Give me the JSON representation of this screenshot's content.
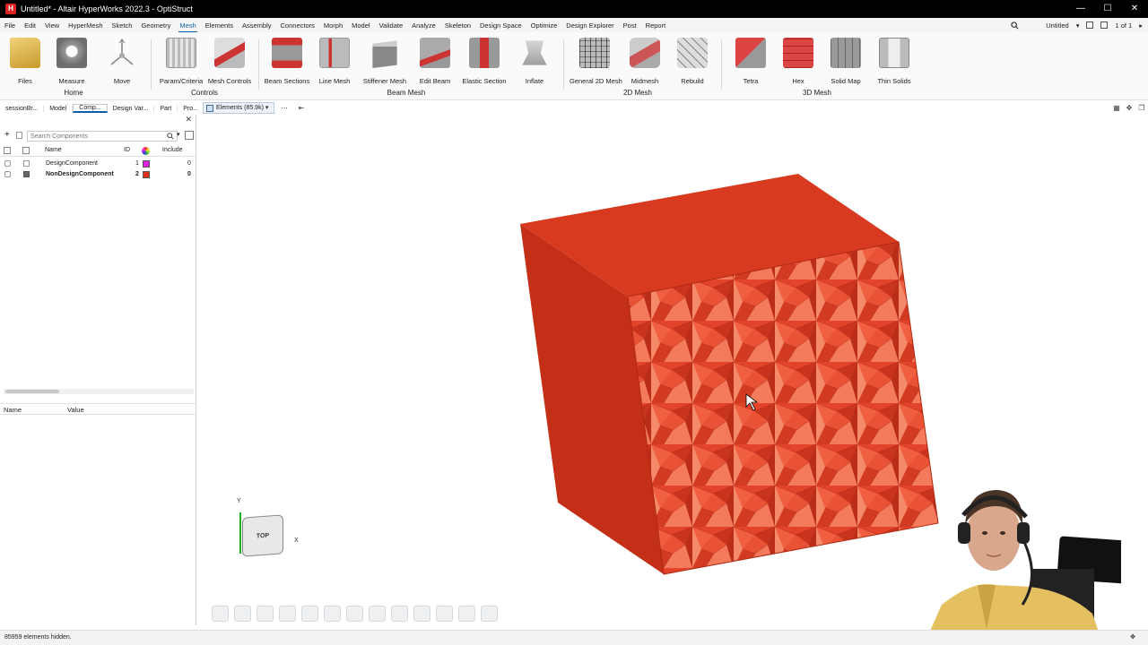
{
  "window": {
    "title": "Untitled* - Altair HyperWorks 2022.3 - OptiStruct",
    "controls": [
      "—",
      "☐",
      "✕"
    ]
  },
  "menubar": {
    "items": [
      "File",
      "Edit",
      "View",
      "HyperMesh",
      "Sketch",
      "Geometry",
      "Mesh",
      "Elements",
      "Assembly",
      "Connectors",
      "Morph",
      "Model",
      "Validate",
      "Analyze",
      "Skeleton",
      "Design Space",
      "Optimize",
      "Design Explorer",
      "Post",
      "Report"
    ],
    "active": "Mesh",
    "session": "Untitled",
    "page": "1 of 1"
  },
  "ribbon": {
    "tools": [
      "Files",
      "Measure",
      "Move",
      "Param/Criteria",
      "Mesh Controls",
      "Beam Sections",
      "Line Mesh",
      "Stiffener Mesh",
      "Edit Beam",
      "Elastic Section",
      "Inflate",
      "General 2D Mesh",
      "Midmesh",
      "Rebuild",
      "Tetra",
      "Hex",
      "Solid Map",
      "Thin Solids"
    ],
    "groups": [
      "Home",
      "Controls",
      "Beam Mesh",
      "2D Mesh",
      "3D Mesh"
    ]
  },
  "browser": {
    "tabs": [
      "sessionBr...",
      "Model",
      "Comp...",
      "Design Var...",
      "Part",
      "Pro..."
    ],
    "active_tab": "Comp...",
    "search_placeholder": "Search Components",
    "columns": [
      "Name",
      "ID",
      "Include"
    ],
    "rows": [
      {
        "name": "DesignComponent",
        "id": "1",
        "color": "#e020e0",
        "include": "0"
      },
      {
        "name": "NonDesignComponent",
        "id": "2",
        "color": "#e03020",
        "include": "0"
      }
    ],
    "property_columns": [
      "Name",
      "Value"
    ]
  },
  "selector": {
    "label": "Elements (85.9k)"
  },
  "viewport": {
    "model_color": "#d93a20",
    "triad": {
      "face": "TOP",
      "axis_x": "X",
      "axis_y": "Y"
    }
  },
  "status": {
    "message": "85959 elements hidden."
  }
}
